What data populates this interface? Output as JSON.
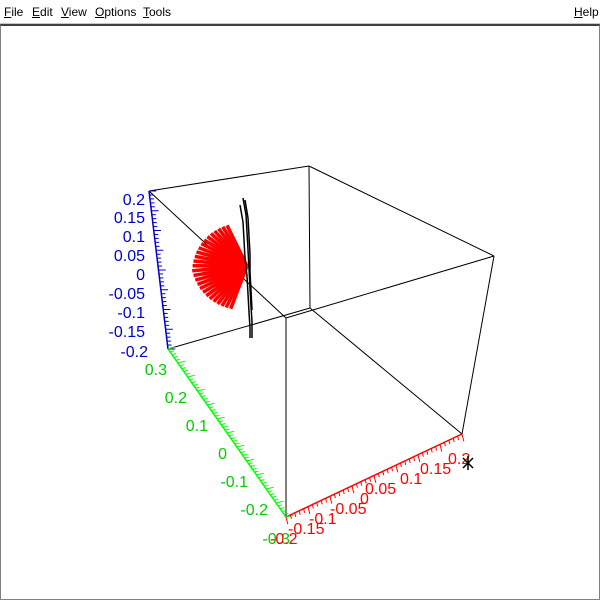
{
  "menubar": {
    "file": "File",
    "edit": "Edit",
    "view": "View",
    "options": "Options",
    "tools": "Tools",
    "help": "Help"
  },
  "colors": {
    "x_axis": "#ff0000",
    "y_axis": "#00ff00",
    "z_axis": "#0000cc",
    "box": "#000000",
    "vectors": "#ff0000",
    "curve": "#000000"
  },
  "plot": {
    "icons": [
      "rotate-cursor-icon"
    ],
    "x_ticks": [
      "-0.2",
      "-0.15",
      "-0.1",
      "-0.05",
      "0",
      "0.05",
      "0.1",
      "0.15",
      "0.2"
    ],
    "y_ticks": [
      "0.3",
      "0.2",
      "0.1",
      "0",
      "-0.1",
      "-0.2",
      "-0.3"
    ],
    "z_ticks": [
      "0.2",
      "0.15",
      "0.1",
      "0.05",
      "0",
      "-0.05",
      "-0.1",
      "-0.15",
      "-0.2"
    ]
  }
}
